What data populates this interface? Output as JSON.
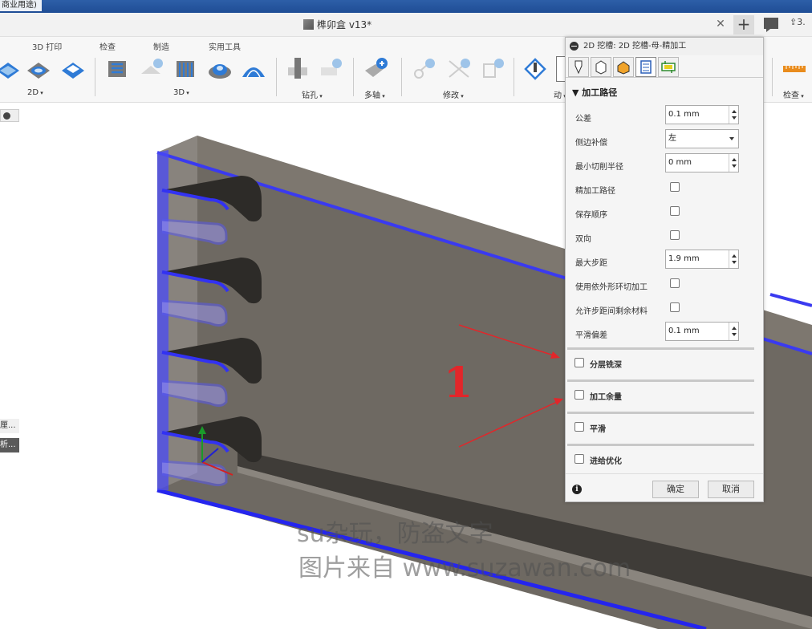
{
  "window": {
    "title_fragment": "商业用途)"
  },
  "tabbar": {
    "doc_title": "榫卯盒 v13*",
    "extra_text": "3."
  },
  "toolbar": {
    "top_labels": [
      "3D 打印",
      "检查",
      "制造",
      "实用工具"
    ],
    "groups": [
      "2D",
      "3D",
      "钻孔",
      "多轴",
      "修改",
      "检查"
    ],
    "partial_text": "动"
  },
  "side_chips": [
    "厘...",
    "析..."
  ],
  "dialog": {
    "header_title": "2D 挖槽: 2D 挖槽-母-精加工",
    "section_title": "加工路径",
    "fields": {
      "tolerance": {
        "label": "公差",
        "value": "0.1 mm"
      },
      "compensation": {
        "label": "侧边补偿",
        "value": "左"
      },
      "min_radius": {
        "label": "最小切削半径",
        "value": "0 mm"
      },
      "finish_path": {
        "label": "精加工路径"
      },
      "keep_order": {
        "label": "保存顺序"
      },
      "both_ways": {
        "label": "双向"
      },
      "max_stepover": {
        "label": "最大步距",
        "value": "1.9 mm"
      },
      "outer_loop": {
        "label": "使用依外形环切加工"
      },
      "allow_stock": {
        "label": "允许步距间剩余材料"
      },
      "smooth_offset": {
        "label": "平滑偏差",
        "value": "0.1 mm"
      }
    },
    "groups": {
      "multiple_depths": "分层铣深",
      "stock_to_leave": "加工余量",
      "smoothing": "平滑",
      "feed_optimization": "进给优化"
    },
    "buttons": {
      "ok": "确定",
      "cancel": "取消"
    }
  },
  "annotation": {
    "number": "1"
  },
  "watermark": {
    "line1": "su杂玩，防盗文字",
    "line2": "图片来自 www.suzawan.com"
  },
  "colors": {
    "selection_blue": "#3a3af0",
    "arrow_red": "#e2262a",
    "model_gray": "#6f6a63"
  }
}
